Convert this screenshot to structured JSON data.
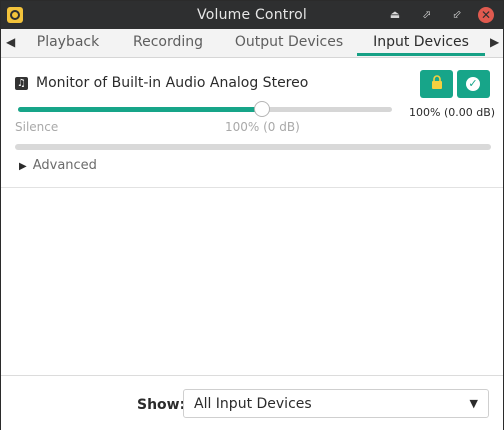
{
  "window": {
    "title": "Volume Control"
  },
  "titlebar": {
    "buttons": {
      "upload": "⏏",
      "maximize": "⬀",
      "minimize": "⬃",
      "close": "✕"
    }
  },
  "tabs": {
    "items": [
      {
        "label": "Playback"
      },
      {
        "label": "Recording"
      },
      {
        "label": "Output Devices"
      },
      {
        "label": "Input Devices"
      }
    ],
    "selected": "Input Devices",
    "left_arrow": "◀",
    "right_arrow": "▶"
  },
  "device": {
    "name": "Monitor of Built-in Audio Analog Stereo",
    "icon": "music-note-icon",
    "volume_percent": 100,
    "volume_readout": "100% (0.00 dB)",
    "scale_min_label": "Silence",
    "scale_mid_label": "100% (0 dB)",
    "slider_fraction": 0.65,
    "peak_level": 0,
    "mute_icon": "lock-icon",
    "default_icon": "check-icon"
  },
  "advanced": {
    "label": "Advanced",
    "expanded": false
  },
  "footer": {
    "show_label": "Show:",
    "show_value": "All Input Devices"
  },
  "colors": {
    "accent": "#17a589",
    "titlebar": "#2e2f30",
    "close": "#e05a4f"
  }
}
